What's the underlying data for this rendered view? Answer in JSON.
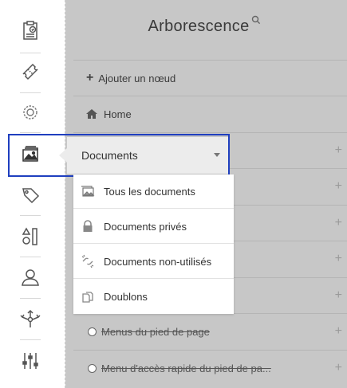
{
  "panel": {
    "title": "Arborescence"
  },
  "rows": {
    "add_node": "Ajouter un nœud",
    "home": "Home",
    "footer_menus": "Menus du pied de page",
    "footer_quick": "Menu d'accès rapide du pied de pa..."
  },
  "documents": {
    "label": "Documents",
    "items": [
      {
        "label": "Tous les documents",
        "icon": "images-icon"
      },
      {
        "label": "Documents privés",
        "icon": "lock-icon"
      },
      {
        "label": "Documents non-utilisés",
        "icon": "broken-link-icon"
      },
      {
        "label": "Doublons",
        "icon": "duplicate-icon"
      }
    ]
  },
  "rail": {
    "items": [
      "clipboard-icon",
      "ticket-icon",
      "settings-icon",
      "media-icon",
      "tag-icon",
      "shapes-icon",
      "user-icon",
      "network-icon",
      "sliders-icon"
    ]
  },
  "plus_glyph": "+",
  "colors": {
    "focus": "#1f3fbf",
    "panel": "#c7c7c7"
  }
}
